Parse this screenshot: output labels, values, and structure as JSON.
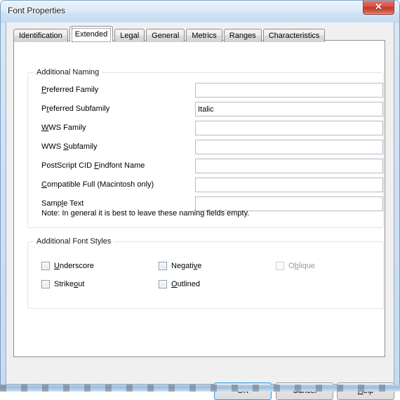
{
  "window": {
    "title": "Font Properties",
    "close_label": "✕",
    "close_icon": "close-icon"
  },
  "tabs": [
    {
      "label": "Identification",
      "selected": false
    },
    {
      "label": "Extended",
      "selected": true
    },
    {
      "label": "Legal",
      "selected": false
    },
    {
      "label": "General",
      "selected": false
    },
    {
      "label": "Metrics",
      "selected": false
    },
    {
      "label": "Ranges",
      "selected": false
    },
    {
      "label": "Characteristics",
      "selected": false
    }
  ],
  "naming_group": {
    "title": "Additional Naming",
    "fields": [
      {
        "label_pre": "",
        "acc": "P",
        "label_post": "referred Family",
        "value": "",
        "name": "preferred-family"
      },
      {
        "label_pre": "P",
        "acc": "r",
        "label_post": "eferred Subfamily",
        "value": "Italic",
        "name": "preferred-subfamily"
      },
      {
        "label_pre": "",
        "acc": "W",
        "label_post": "WS Family",
        "value": "",
        "name": "wws-family"
      },
      {
        "label_pre": "WWS ",
        "acc": "S",
        "label_post": "ubfamily",
        "value": "",
        "name": "wws-subfamily"
      },
      {
        "label_pre": "PostScript CID ",
        "acc": "F",
        "label_post": "indfont Name",
        "value": "",
        "name": "postscript-cid-findfont-name"
      },
      {
        "label_pre": "",
        "acc": "C",
        "label_post": "ompatible Full (Macintosh only)",
        "value": "",
        "name": "compatible-full"
      },
      {
        "label_pre": "Samp",
        "acc": "l",
        "label_post": "e Text",
        "value": "",
        "name": "sample-text"
      }
    ],
    "note": "Note: In general it is best to leave these naming fields empty."
  },
  "styles_group": {
    "title": "Additional Font Styles",
    "checkboxes": [
      {
        "pre": "",
        "acc": "U",
        "post": "nderscore",
        "checked": false,
        "disabled": false,
        "name": "underscore"
      },
      {
        "pre": "Strike",
        "acc": "o",
        "post": "ut",
        "checked": false,
        "disabled": false,
        "name": "strikeout"
      },
      {
        "pre": "Negati",
        "acc": "v",
        "post": "e",
        "checked": false,
        "disabled": false,
        "name": "negative"
      },
      {
        "pre": "",
        "acc": "O",
        "post": "utlined",
        "checked": false,
        "disabled": false,
        "name": "outlined"
      },
      {
        "pre": "O",
        "acc": "b",
        "post": "lique",
        "checked": false,
        "disabled": true,
        "name": "oblique"
      }
    ]
  },
  "footer": {
    "ok_label": "OK",
    "cancel_label": "Cancel",
    "help_pre": "",
    "help_acc": "H",
    "help_post": "elp"
  },
  "colors": {
    "accent": "#2e9fe0",
    "close_button": "#c03526",
    "dialog_face": "#f0f0f0",
    "panel": "#ffffff",
    "glass": "#cfe2f5"
  }
}
